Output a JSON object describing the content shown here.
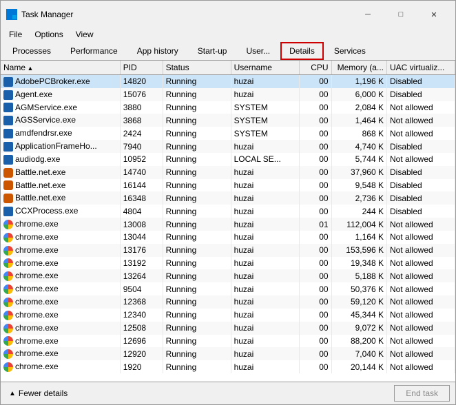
{
  "window": {
    "title": "Task Manager",
    "minimize_label": "─",
    "maximize_label": "□",
    "close_label": "✕"
  },
  "menu": {
    "items": [
      "File",
      "Options",
      "View"
    ]
  },
  "tabs": [
    {
      "id": "processes",
      "label": "Processes"
    },
    {
      "id": "performance",
      "label": "Performance"
    },
    {
      "id": "app-history",
      "label": "App history"
    },
    {
      "id": "startup",
      "label": "Start-up"
    },
    {
      "id": "users",
      "label": "User..."
    },
    {
      "id": "details",
      "label": "Details",
      "active": true
    },
    {
      "id": "services",
      "label": "Services"
    }
  ],
  "columns": [
    {
      "id": "name",
      "label": "Name"
    },
    {
      "id": "pid",
      "label": "PID"
    },
    {
      "id": "status",
      "label": "Status"
    },
    {
      "id": "username",
      "label": "Username"
    },
    {
      "id": "cpu",
      "label": "CPU"
    },
    {
      "id": "memory",
      "label": "Memory (a..."
    },
    {
      "id": "uac",
      "label": "UAC virtualiz..."
    }
  ],
  "rows": [
    {
      "name": "AdobePCBroker.exe",
      "pid": "14820",
      "status": "Running",
      "username": "huzai",
      "cpu": "00",
      "memory": "1,196 K",
      "uac": "Disabled",
      "selected": true,
      "icon": "blue"
    },
    {
      "name": "Agent.exe",
      "pid": "15076",
      "status": "Running",
      "username": "huzai",
      "cpu": "00",
      "memory": "6,000 K",
      "uac": "Disabled",
      "icon": "blue"
    },
    {
      "name": "AGMService.exe",
      "pid": "3880",
      "status": "Running",
      "username": "SYSTEM",
      "cpu": "00",
      "memory": "2,084 K",
      "uac": "Not allowed",
      "icon": "blue"
    },
    {
      "name": "AGSService.exe",
      "pid": "3868",
      "status": "Running",
      "username": "SYSTEM",
      "cpu": "00",
      "memory": "1,464 K",
      "uac": "Not allowed",
      "icon": "blue"
    },
    {
      "name": "amdfendrsr.exe",
      "pid": "2424",
      "status": "Running",
      "username": "SYSTEM",
      "cpu": "00",
      "memory": "868 K",
      "uac": "Not allowed",
      "icon": "blue"
    },
    {
      "name": "ApplicationFrameHo...",
      "pid": "7940",
      "status": "Running",
      "username": "huzai",
      "cpu": "00",
      "memory": "4,740 K",
      "uac": "Disabled",
      "icon": "blue"
    },
    {
      "name": "audiodg.exe",
      "pid": "10952",
      "status": "Running",
      "username": "LOCAL SE...",
      "cpu": "00",
      "memory": "5,744 K",
      "uac": "Not allowed",
      "icon": "blue"
    },
    {
      "name": "Battle.net.exe",
      "pid": "14740",
      "status": "Running",
      "username": "huzai",
      "cpu": "00",
      "memory": "37,960 K",
      "uac": "Disabled",
      "icon": "orange"
    },
    {
      "name": "Battle.net.exe",
      "pid": "16144",
      "status": "Running",
      "username": "huzai",
      "cpu": "00",
      "memory": "9,548 K",
      "uac": "Disabled",
      "icon": "orange"
    },
    {
      "name": "Battle.net.exe",
      "pid": "16348",
      "status": "Running",
      "username": "huzai",
      "cpu": "00",
      "memory": "2,736 K",
      "uac": "Disabled",
      "icon": "orange"
    },
    {
      "name": "CCXProcess.exe",
      "pid": "4804",
      "status": "Running",
      "username": "huzai",
      "cpu": "00",
      "memory": "244 K",
      "uac": "Disabled",
      "icon": "blue"
    },
    {
      "name": "chrome.exe",
      "pid": "13008",
      "status": "Running",
      "username": "huzai",
      "cpu": "01",
      "memory": "112,004 K",
      "uac": "Not allowed",
      "icon": "chrome"
    },
    {
      "name": "chrome.exe",
      "pid": "13044",
      "status": "Running",
      "username": "huzai",
      "cpu": "00",
      "memory": "1,164 K",
      "uac": "Not allowed",
      "icon": "chrome"
    },
    {
      "name": "chrome.exe",
      "pid": "13176",
      "status": "Running",
      "username": "huzai",
      "cpu": "00",
      "memory": "153,596 K",
      "uac": "Not allowed",
      "icon": "chrome"
    },
    {
      "name": "chrome.exe",
      "pid": "13192",
      "status": "Running",
      "username": "huzai",
      "cpu": "00",
      "memory": "19,348 K",
      "uac": "Not allowed",
      "icon": "chrome"
    },
    {
      "name": "chrome.exe",
      "pid": "13264",
      "status": "Running",
      "username": "huzai",
      "cpu": "00",
      "memory": "5,188 K",
      "uac": "Not allowed",
      "icon": "chrome"
    },
    {
      "name": "chrome.exe",
      "pid": "9504",
      "status": "Running",
      "username": "huzai",
      "cpu": "00",
      "memory": "50,376 K",
      "uac": "Not allowed",
      "icon": "chrome"
    },
    {
      "name": "chrome.exe",
      "pid": "12368",
      "status": "Running",
      "username": "huzai",
      "cpu": "00",
      "memory": "59,120 K",
      "uac": "Not allowed",
      "icon": "chrome"
    },
    {
      "name": "chrome.exe",
      "pid": "12340",
      "status": "Running",
      "username": "huzai",
      "cpu": "00",
      "memory": "45,344 K",
      "uac": "Not allowed",
      "icon": "chrome"
    },
    {
      "name": "chrome.exe",
      "pid": "12508",
      "status": "Running",
      "username": "huzai",
      "cpu": "00",
      "memory": "9,072 K",
      "uac": "Not allowed",
      "icon": "chrome"
    },
    {
      "name": "chrome.exe",
      "pid": "12696",
      "status": "Running",
      "username": "huzai",
      "cpu": "00",
      "memory": "88,200 K",
      "uac": "Not allowed",
      "icon": "chrome"
    },
    {
      "name": "chrome.exe",
      "pid": "12920",
      "status": "Running",
      "username": "huzai",
      "cpu": "00",
      "memory": "7,040 K",
      "uac": "Not allowed",
      "icon": "chrome"
    },
    {
      "name": "chrome.exe",
      "pid": "1920",
      "status": "Running",
      "username": "huzai",
      "cpu": "00",
      "memory": "20,144 K",
      "uac": "Not allowed",
      "icon": "chrome"
    }
  ],
  "footer": {
    "fewer_details": "Fewer details",
    "end_task": "End task"
  }
}
